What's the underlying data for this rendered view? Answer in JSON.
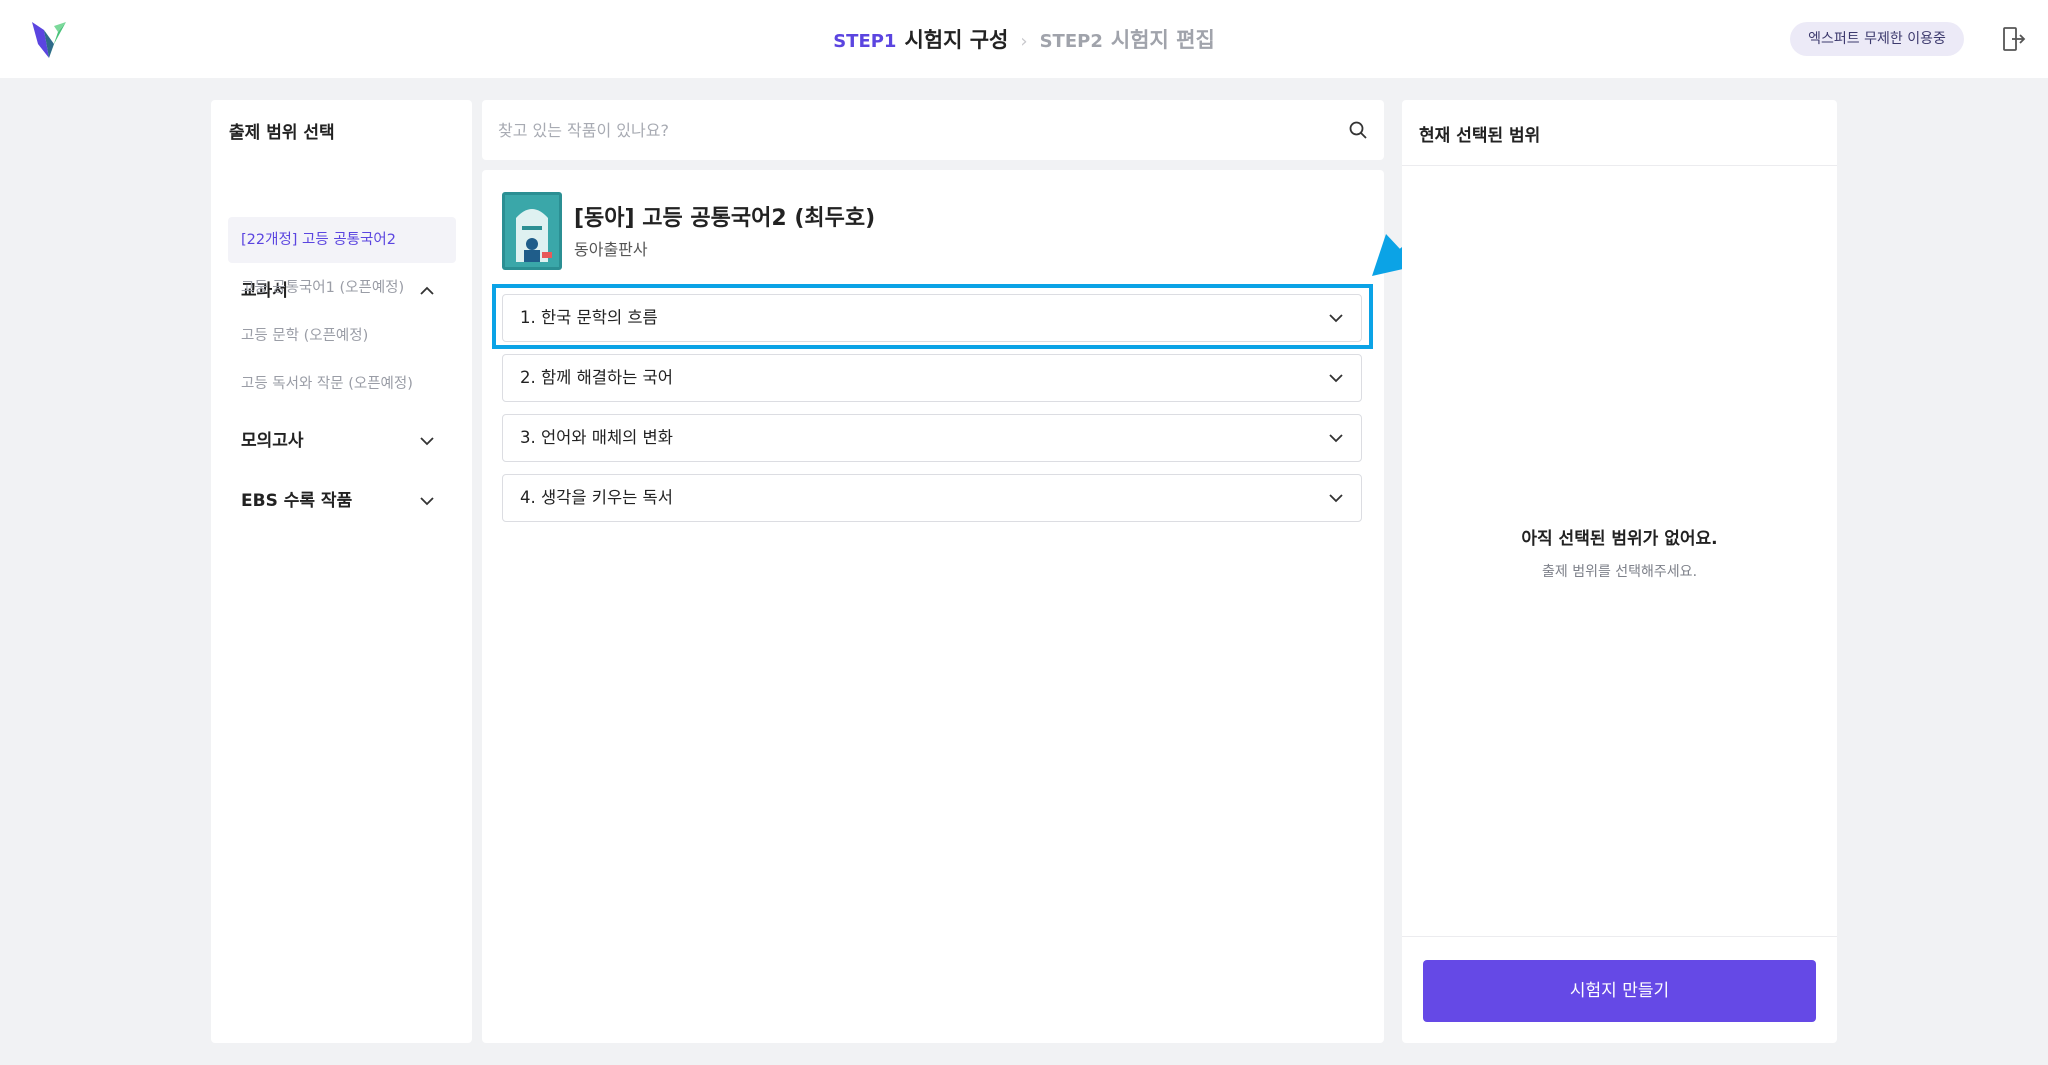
{
  "header": {
    "step1_num": "STEP1",
    "step1_title": "시험지 구성",
    "step2_num": "STEP2",
    "step2_title": "시험지 편집",
    "plan_badge": "엑스퍼트 무제한 이용중",
    "logo_icon": "brand-v-logo",
    "exit_icon": "exit-door-icon"
  },
  "left": {
    "title": "출제 범위 선택",
    "categories": [
      {
        "label": "교과서",
        "expanded": true,
        "items": [
          {
            "label": "[22개정] 고등 공통국어2",
            "active": true
          },
          {
            "label": "고등 공통국어1 (오픈예정)",
            "active": false
          },
          {
            "label": "고등 문학 (오픈예정)",
            "active": false
          },
          {
            "label": "고등 독서와 작문 (오픈예정)",
            "active": false
          }
        ]
      },
      {
        "label": "모의고사",
        "expanded": false
      },
      {
        "label": "EBS 수록 작품",
        "expanded": false
      }
    ]
  },
  "search": {
    "placeholder": "찾고 있는 작품이 있나요?",
    "value": ""
  },
  "book": {
    "title": "[동아] 고등 공통국어2 (최두호)",
    "publisher": "동아출판사",
    "chapters": [
      {
        "label": "1. 한국 문학의 흐름",
        "highlighted": true
      },
      {
        "label": "2. 함께 해결하는 국어",
        "highlighted": false
      },
      {
        "label": "3. 언어와 매체의 변화",
        "highlighted": false
      },
      {
        "label": "4. 생각을 키우는 독서",
        "highlighted": false
      }
    ]
  },
  "right": {
    "title": "현재 선택된 범위",
    "empty_title": "아직 선택된 범위가 없어요.",
    "empty_sub": "출제 범위를 선택해주세요.",
    "button": "시험지 만들기"
  },
  "colors": {
    "accent": "#6549e6",
    "highlight": "#0ba3e6",
    "background": "#f1f2f4"
  }
}
